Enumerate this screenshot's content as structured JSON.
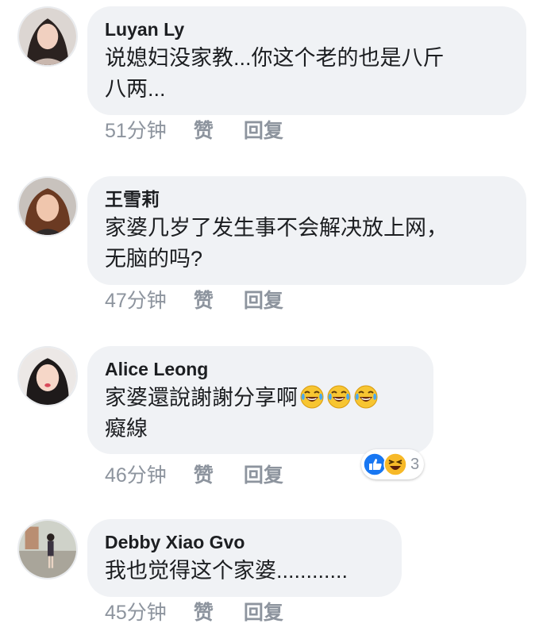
{
  "comments": [
    {
      "author": "Luyan Ly",
      "text": "说媳妇没家教...你这个老的也是八斤\n八两...",
      "time": "51分钟",
      "like_label": "赞",
      "reply_label": "回复"
    },
    {
      "author": "王雪莉",
      "text": "家婆几岁了发生事不会解决放上网，\n无脑的吗?",
      "time": "47分钟",
      "like_label": "赞",
      "reply_label": "回复"
    },
    {
      "author": "Alice Leong",
      "text": "家婆還說謝謝分享啊",
      "text2": "癡線",
      "emojis": [
        "tears-of-joy-emoji",
        "tears-of-joy-emoji",
        "tears-of-joy-emoji"
      ],
      "time": "46分钟",
      "like_label": "赞",
      "reply_label": "回复",
      "reactions": {
        "icons": [
          "like-reaction-icon",
          "haha-reaction-icon"
        ],
        "count": "3"
      }
    },
    {
      "author": "Debby Xiao Gvo",
      "text": "我也觉得这个家婆............",
      "time": "45分钟",
      "like_label": "赞",
      "reply_label": "回复"
    }
  ],
  "colors": {
    "bubble": "#f0f2f5",
    "meta": "#8d949e",
    "like_blue": "#1877f2",
    "haha_yellow": "#f7b928"
  }
}
